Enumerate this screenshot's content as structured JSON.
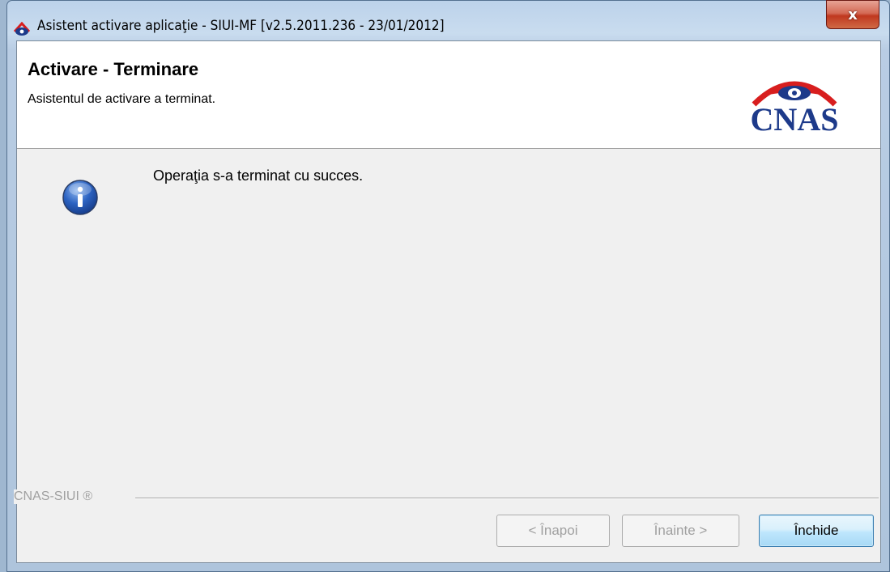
{
  "window": {
    "title": "Asistent activare aplicaţie - SIUI-MF [v2.5.2011.236 - 23/01/2012]",
    "close_glyph": "x"
  },
  "header": {
    "title": "Activare - Terminare",
    "subtitle": "Asistentul de activare a terminat.",
    "logo_text": "CNAS"
  },
  "body": {
    "icon": "info-icon",
    "message": "Operaţia s-a terminat cu succes."
  },
  "footer": {
    "brand": "CNAS-SIUI ®",
    "buttons": {
      "back": "< Înapoi",
      "next": "Înainte >",
      "close": "Închide"
    }
  },
  "colors": {
    "logo_blue": "#1d3a8a",
    "logo_red": "#d81e1e",
    "info_blue": "#1f4fa8"
  }
}
